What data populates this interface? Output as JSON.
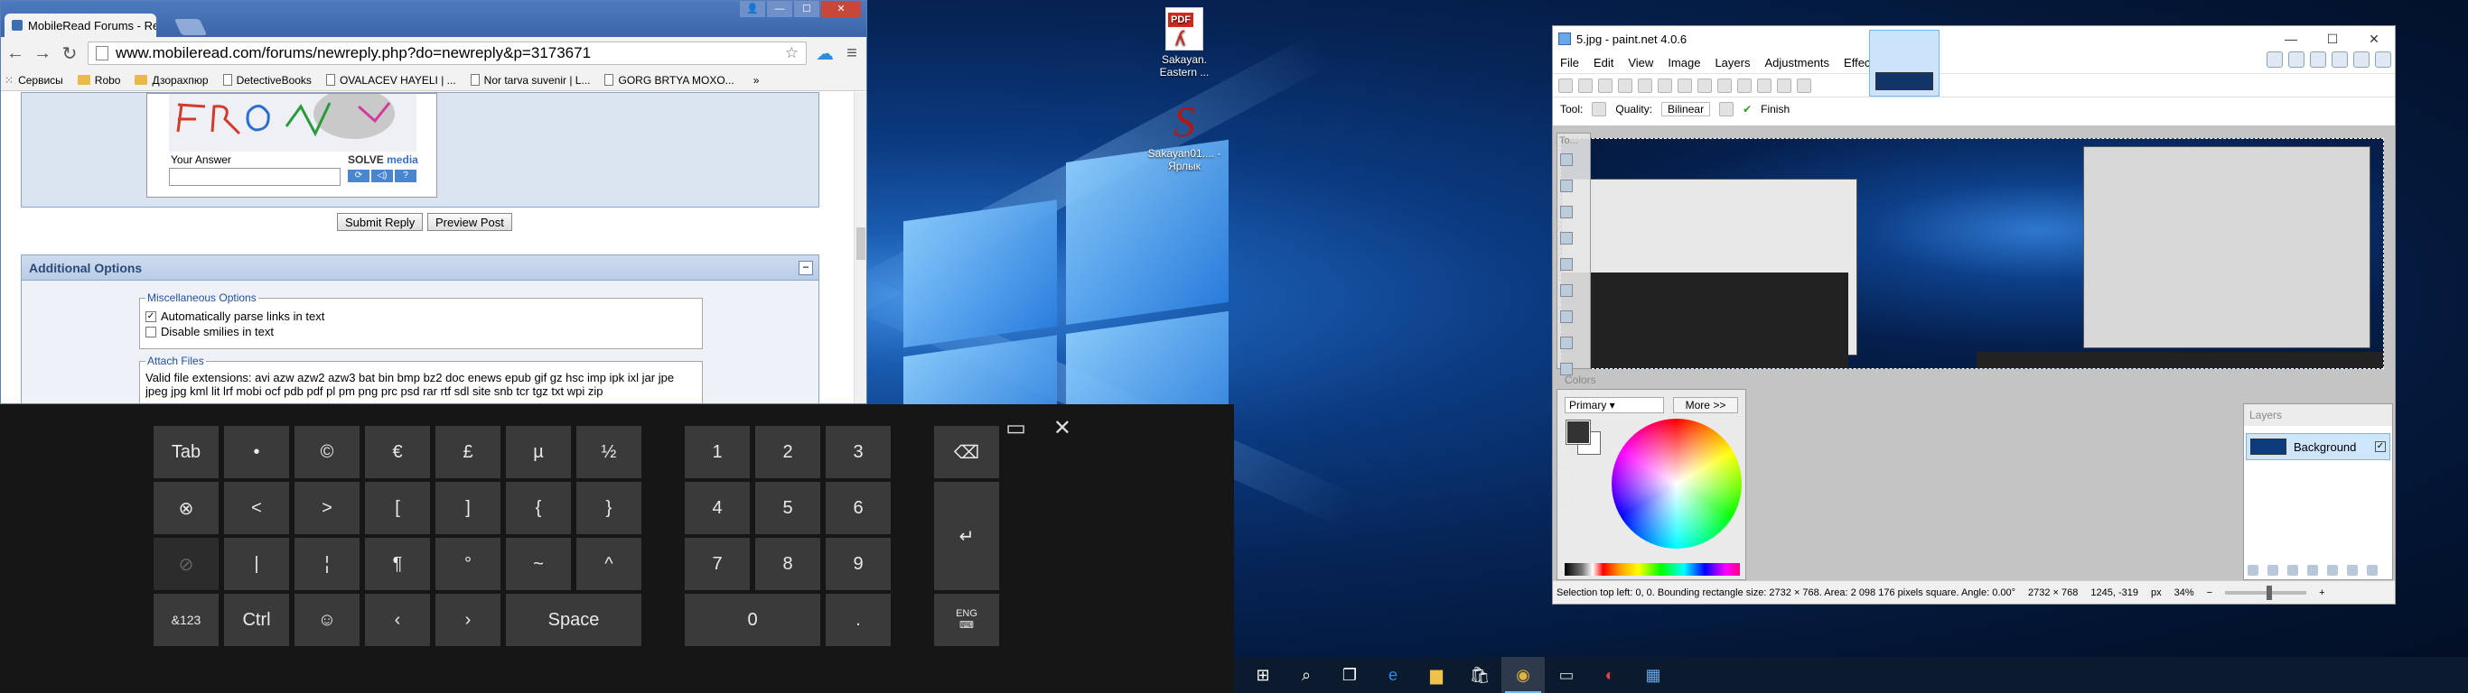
{
  "desktop": {
    "icons": [
      {
        "label": "Sakayan. Eastern ...",
        "badge": "PDF"
      },
      {
        "label": "Sakayan01.... - Ярлык",
        "glyph": "S"
      }
    ]
  },
  "chrome": {
    "tab_title": "MobileRead Forums - Rep",
    "url": "www.mobileread.com/forums/newreply.php?do=newreply&p=3173671",
    "bookmarks": [
      {
        "label": "Сервисы",
        "icon": "apps-icon"
      },
      {
        "label": "Robo",
        "icon": "folder-icon"
      },
      {
        "label": "Дзорахпюр",
        "icon": "folder-icon"
      },
      {
        "label": "DetectiveBooks",
        "icon": "page-icon"
      },
      {
        "label": "OVALACEV HAYELI | ...",
        "icon": "page-icon"
      },
      {
        "label": "Nor tarva suvenir | L...",
        "icon": "page-icon"
      },
      {
        "label": "GORG BRTYA MOXO...",
        "icon": "page-icon"
      },
      {
        "label": "»",
        "icon": "more-icon"
      }
    ],
    "captcha": {
      "text": "FROOD",
      "answer_label": "Your Answer",
      "solve_brand": "SOLVE",
      "solve_brand_suffix": "media",
      "solve_buttons": [
        "⟳",
        "◁)",
        "?"
      ]
    },
    "buttons": {
      "submit": "Submit Reply",
      "preview": "Preview Post"
    },
    "additional": {
      "title": "Additional Options",
      "collapse": "−",
      "misc_legend": "Miscellaneous Options",
      "opt_parse_links": "Automatically parse links in text",
      "opt_parse_links_checked": true,
      "opt_disable_smilies": "Disable smilies in text",
      "opt_disable_smilies_checked": false,
      "attach_legend": "Attach Files",
      "valid_ext": "Valid file extensions: avi azw azw2 azw3 bat bin bmp bz2 doc enews epub gif gz hsc imp ipk ixl jar jpe",
      "valid_ext_2": "jpeg jpg kml lit lrf mobi ocf pdb pdf pl pm png prc psd rar rtf sdl site snb tcr tgz txt wpi zip"
    }
  },
  "keyboard": {
    "rows": [
      [
        "Tab",
        "•",
        "©",
        "€",
        "£",
        "µ",
        "½"
      ],
      [
        "⊗",
        "<",
        ">",
        "[",
        "]",
        "{",
        "}"
      ],
      [
        "⊘",
        "|",
        "¦",
        "¶",
        "°",
        "~",
        "^"
      ],
      [
        "&123",
        "Ctrl",
        "☺",
        "‹",
        "›",
        "Space"
      ]
    ],
    "numpad": [
      [
        "1",
        "2",
        "3"
      ],
      [
        "4",
        "5",
        "6"
      ],
      [
        "7",
        "8",
        "9"
      ],
      [
        "0",
        "."
      ]
    ],
    "backspace": "⌫",
    "enter": "↵",
    "lang": "ENG",
    "lang_icon": "⌨",
    "top_icons": [
      "▭",
      "✕"
    ]
  },
  "paintnet": {
    "title": "5.jpg - paint.net 4.0.6",
    "window_buttons": [
      "—",
      "☐",
      "✕"
    ],
    "menu": [
      "File",
      "Edit",
      "View",
      "Image",
      "Layers",
      "Adjustments",
      "Effects"
    ],
    "tool_label": "Tool:",
    "quality_label": "Quality:",
    "quality_value": "Bilinear",
    "finish": "Finish",
    "colors_panel_title": "Colors",
    "tools_panel_title": "To...",
    "primary_label": "Primary",
    "more_label": "More >>",
    "layers_title": "Layers",
    "layer_name": "Background",
    "layer_visible": "✓",
    "status_selection": "Selection top left: 0, 0. Bounding rectangle size: 2732 × 768. Area: 2 098 176 pixels square. Angle: 0.00°",
    "status_size": "2732 × 768",
    "status_pos": "1245, -319",
    "status_units": "px",
    "status_zoom": "34%"
  },
  "taskbar": {
    "items": [
      {
        "name": "start-button",
        "glyph": "⊞",
        "color": "#ffffff"
      },
      {
        "name": "search-button",
        "glyph": "⌕",
        "color": "#ffffff"
      },
      {
        "name": "task-view-button",
        "glyph": "❐",
        "color": "#ffffff"
      },
      {
        "name": "edge-icon",
        "glyph": "e",
        "color": "#2f8ae6"
      },
      {
        "name": "file-explorer-icon",
        "glyph": "▆",
        "color": "#f0c24a"
      },
      {
        "name": "store-icon",
        "glyph": "🛍",
        "color": "#ffffff"
      },
      {
        "name": "chrome-icon",
        "glyph": "◉",
        "color": "#e0b43a"
      },
      {
        "name": "window-icon",
        "glyph": "▭",
        "color": "#c0c8d8"
      },
      {
        "name": "media-icon",
        "glyph": "◐",
        "color": "#e04040"
      },
      {
        "name": "paintnet-icon",
        "glyph": "▦",
        "color": "#6aa7e8"
      }
    ],
    "active_index": 6
  }
}
